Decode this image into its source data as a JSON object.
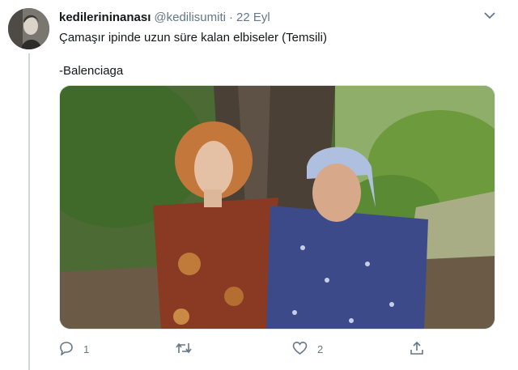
{
  "tweet": {
    "display_name": "kedilerininanası",
    "handle": "@kedilisumiti",
    "separator": "·",
    "time": "22 Eyl",
    "text_line1": "Çamaşır ipinde uzun süre kalan elbiseler (Temsili)",
    "text_line2": "-Balenciaga"
  },
  "actions": {
    "reply_count": "1",
    "like_count": "2"
  },
  "icons": {
    "menu": "chevron-down-icon",
    "reply": "reply-icon",
    "retweet": "retweet-icon",
    "like": "heart-icon",
    "share": "share-icon"
  },
  "colors": {
    "text_primary": "#14171a",
    "text_secondary": "#657786",
    "thread_line": "#ccd6dd"
  }
}
